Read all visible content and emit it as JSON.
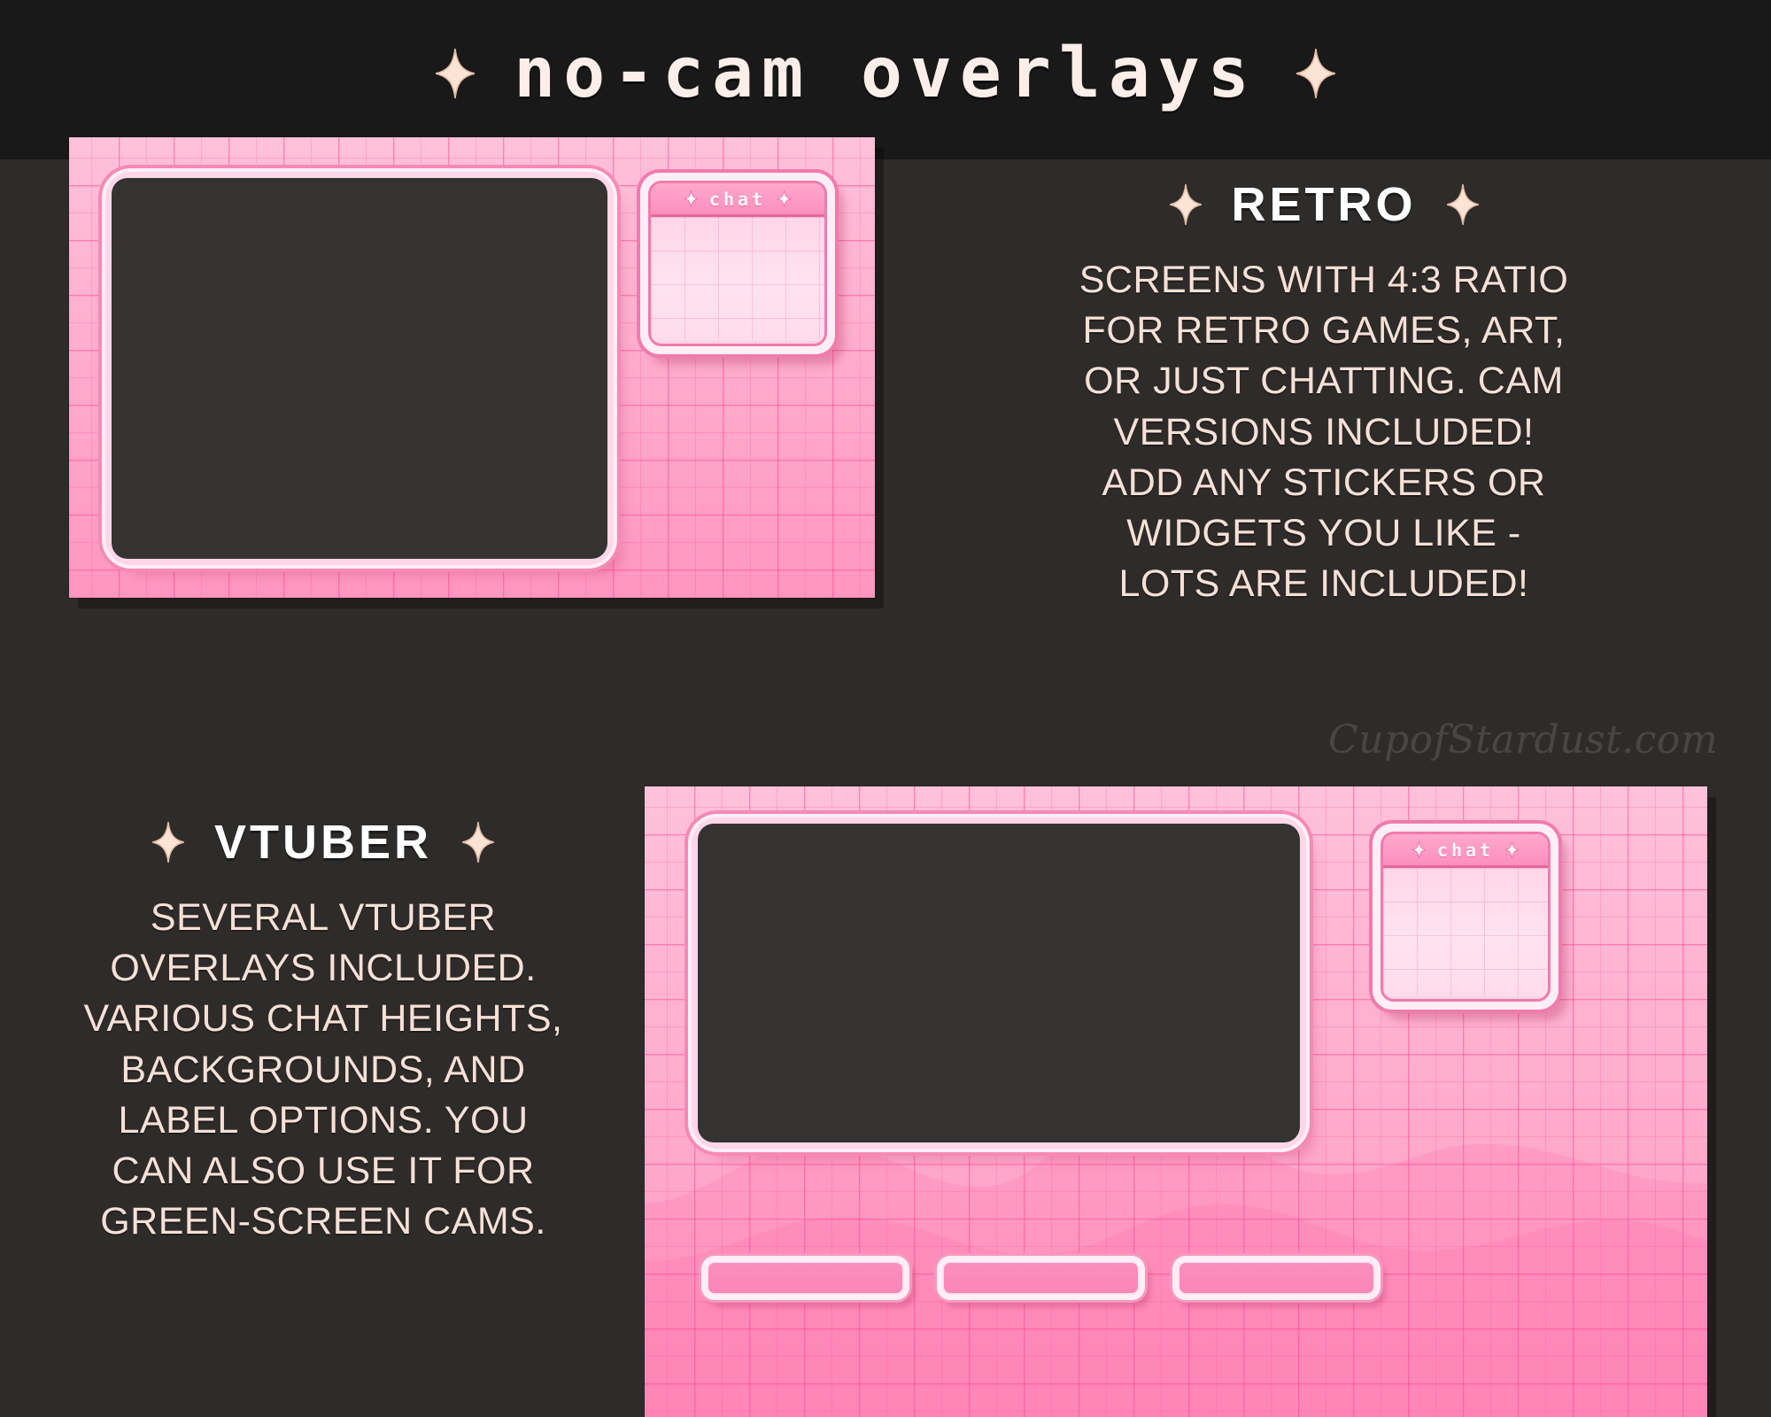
{
  "page": {
    "title": "no-cam overlays",
    "background_dark": "#1b1b1b",
    "background_body": "#2d2c2a",
    "accent_pink": "#ffa6c9",
    "accent_deep_pink": "#f07bad",
    "text_cream": "#f9e0d6"
  },
  "watermark": {
    "text": "CupofStardust.com"
  },
  "sparkle": {
    "name": "sparkle-icon",
    "color": "#fde2d4"
  },
  "retro": {
    "heading": "RETRO",
    "lines": [
      "SCREENS WITH 4:3 RATIO",
      "FOR RETRO GAMES, ART,",
      "OR JUST CHATTING. CAM",
      "VERSIONS INCLUDED!",
      "ADD ANY STICKERS OR",
      "WIDGETS YOU LIKE -",
      "LOTS ARE INCLUDED!"
    ]
  },
  "vtuber": {
    "heading": "VTUBER",
    "lines": [
      "SEVERAL VTUBER",
      "OVERLAYS INCLUDED.",
      "VARIOUS CHAT HEIGHTS,",
      "BACKGROUNDS, AND",
      "LABEL OPTIONS. YOU",
      "CAN ALSO USE IT FOR",
      "GREEN-SCREEN CAMS."
    ]
  },
  "retro_overlay": {
    "name": "retro-overlay-preview",
    "chat": {
      "title": "chat"
    }
  },
  "vtuber_overlay": {
    "name": "vtuber-overlay-preview",
    "chat": {
      "title": "chat"
    },
    "labels": [
      "",
      "",
      ""
    ]
  }
}
